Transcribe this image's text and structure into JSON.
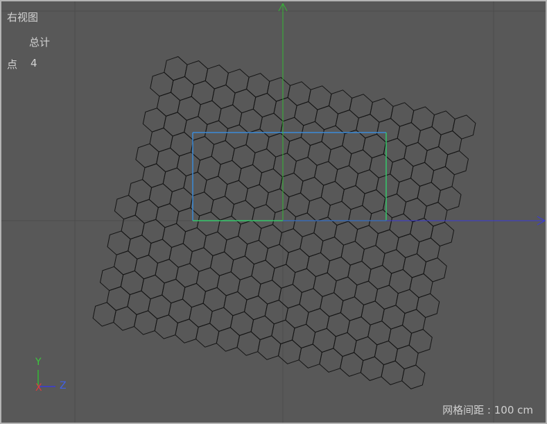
{
  "viewport": {
    "title": "右视图",
    "stats": {
      "header": "总计",
      "points_label": "点",
      "points_value": "4"
    },
    "grid_spacing_label": "网格间距 : 100 cm"
  },
  "axis_gizmo": {
    "y_label": "Y",
    "x_label": "X",
    "z_label": "Z"
  },
  "colors": {
    "background": "#585858",
    "grid_line": "#4c4c4c",
    "hex_stroke": "#141414",
    "y_axis": "#34b834",
    "z_axis": "#3a3ad8",
    "selection_blue": "#3a8ad8",
    "selection_green": "#34c86a"
  }
}
